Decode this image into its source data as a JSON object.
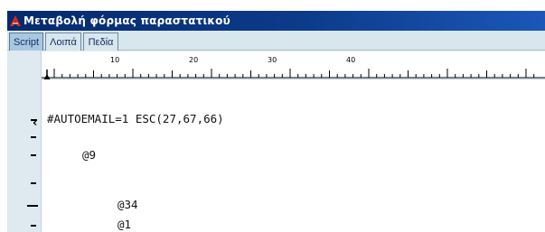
{
  "window": {
    "title": "Μεταβολή φόρμας παραστατικού",
    "icon": "app-logo-icon",
    "title_gradient": [
      "#062a6d",
      "#1b57b8"
    ]
  },
  "tabs": [
    {
      "label": "Script",
      "active": true
    },
    {
      "label": "Λοιπά",
      "active": false
    },
    {
      "label": "Πεδία",
      "active": false
    }
  ],
  "ruler": {
    "labels": [
      "10",
      "20",
      "30",
      "40"
    ],
    "marker_icon": "tab-stop-marker-icon"
  },
  "editor": {
    "lines": [
      "#AUTOEMAIL=1 ESC(27,67,66)",
      "@9",
      "@34",
      "@1"
    ],
    "current_line_marker": "current-line-arrow-icon"
  },
  "colors": {
    "tab_active": "#a7c8de",
    "tab_strip": "#d8e6ee",
    "gutter": "#dfe9f0",
    "logo_red": "#e0261b"
  }
}
